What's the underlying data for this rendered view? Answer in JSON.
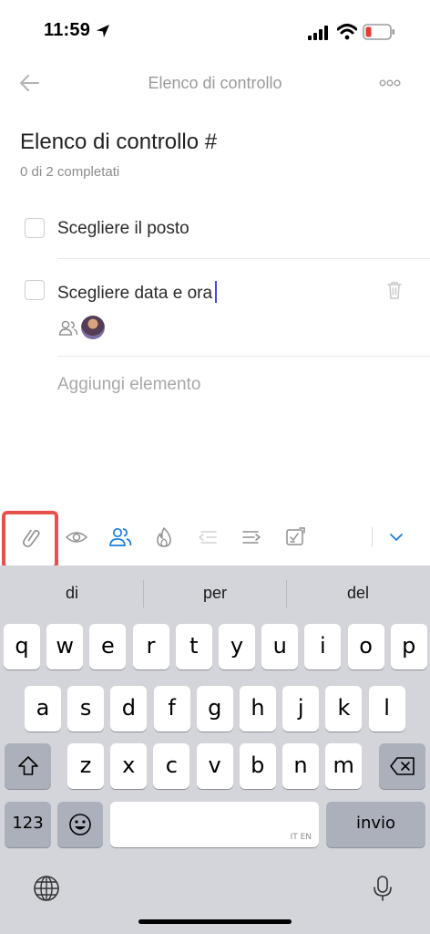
{
  "status_bar": {
    "time": "11:59",
    "icons": [
      "location-arrow-icon",
      "signal-icon",
      "wifi-icon",
      "battery-low-icon"
    ],
    "battery_color": "#e53935"
  },
  "header": {
    "title": "Elenco di controllo",
    "back_icon": "arrow-left-icon",
    "more_icon": "more-dots-icon"
  },
  "checklist": {
    "title": "Elenco di controllo #",
    "progress": "0 di 2 completati",
    "items": [
      {
        "label": "Scegliere il posto",
        "checked": false
      },
      {
        "label": "Scegliere data e ora",
        "checked": false,
        "editing": true
      }
    ],
    "add_placeholder": "Aggiungi elemento"
  },
  "toolbar": {
    "icons": [
      "paperclip-icon",
      "eye-icon",
      "assignees-icon",
      "flame-icon",
      "outdent-icon",
      "indent-icon",
      "convert-task-icon",
      "chevron-down-icon"
    ],
    "highlighted": "paperclip-icon",
    "accent_color": "#1a7ee0",
    "highlight_color": "#e8504b"
  },
  "keyboard": {
    "suggestions": [
      "di",
      "per",
      "del"
    ],
    "row1": [
      "q",
      "w",
      "e",
      "r",
      "t",
      "y",
      "u",
      "i",
      "o",
      "p"
    ],
    "row2": [
      "a",
      "s",
      "d",
      "f",
      "g",
      "h",
      "j",
      "k",
      "l"
    ],
    "row3": [
      "z",
      "x",
      "c",
      "v",
      "b",
      "n",
      "m"
    ],
    "numbers_key": "123",
    "space_tag": "IT EN",
    "return_key": "invio"
  }
}
